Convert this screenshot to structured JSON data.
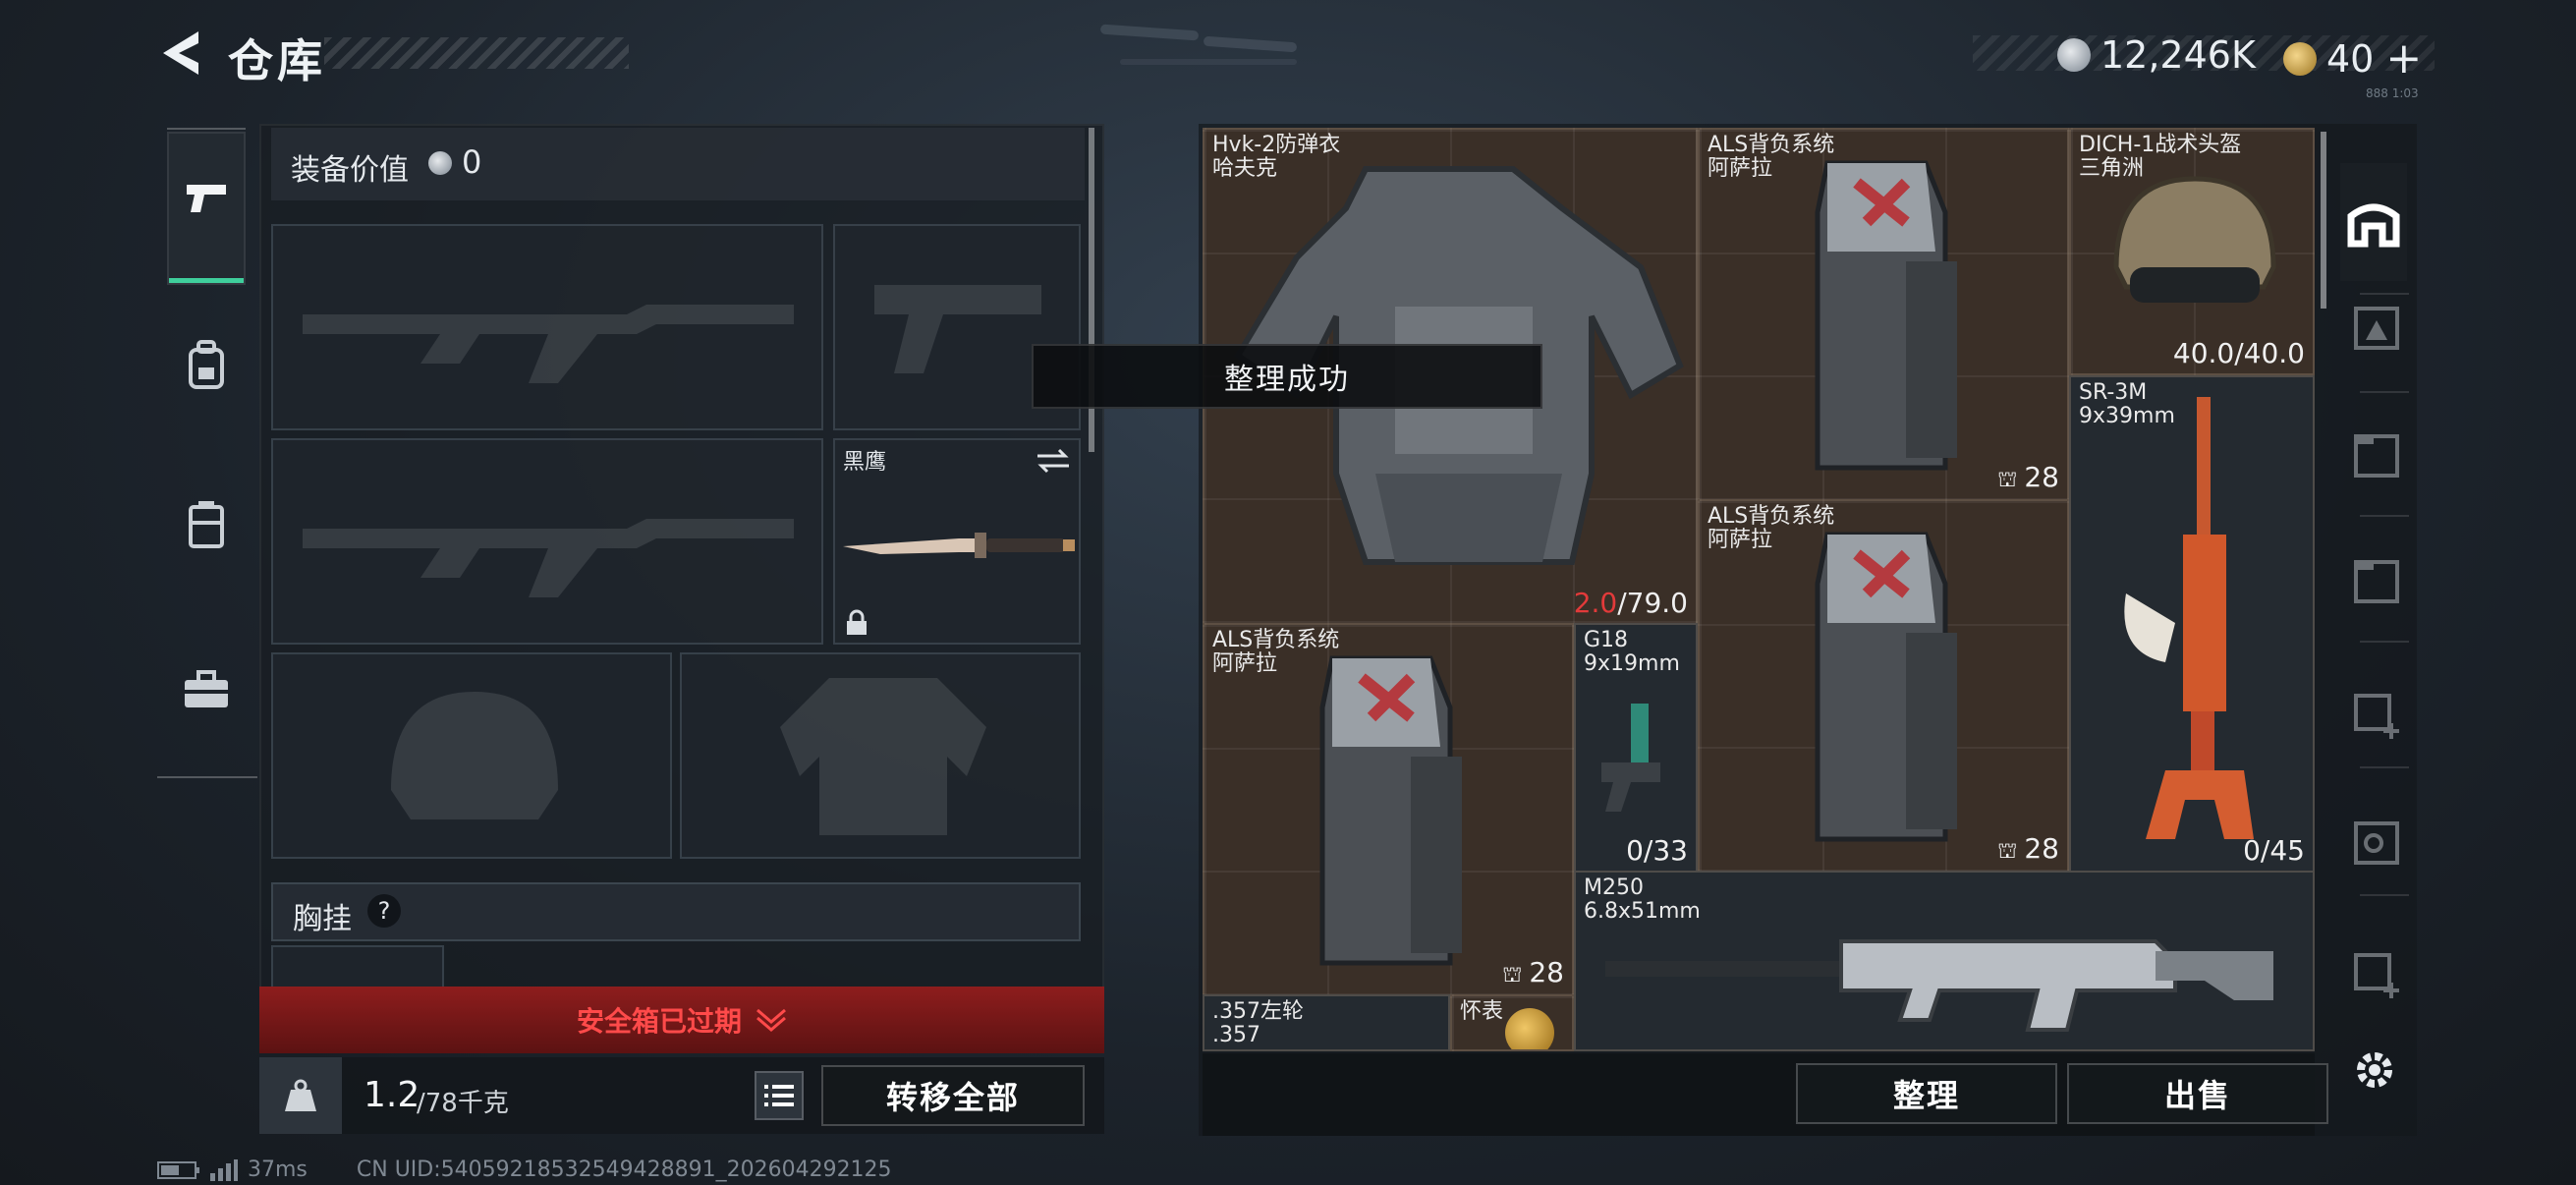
{
  "header": {
    "title": "仓库",
    "currency": {
      "silver": "12,246K",
      "gold": "40",
      "plus": "+"
    },
    "tiny": "888 1:03"
  },
  "loadout": {
    "value_label": "装备价值",
    "value": "0",
    "knife_label": "黑鹰",
    "chest_rig_label": "胸挂",
    "chest_rig_help": "?",
    "safebox_label": "安全箱已过期",
    "weight": "1.2",
    "weight_capacity": "/78千克",
    "transfer_all": "转移全部"
  },
  "toast": "整理成功",
  "stash": {
    "items": [
      {
        "name": "Hvk-2防弹衣",
        "sub": "哈夫克",
        "durability_current": "2.0",
        "durability_max": "/79.0"
      },
      {
        "name": "ALS背负系统",
        "sub": "阿萨拉",
        "count": "28"
      },
      {
        "name": "DICH-1战术头盔",
        "sub": "三角洲",
        "durability": "40.0/40.0"
      },
      {
        "name": "SR-3M",
        "sub": "9x39mm",
        "ammo": "0/45"
      },
      {
        "name": "ALS背负系统",
        "sub": "阿萨拉",
        "count": "28"
      },
      {
        "name": "ALS背负系统",
        "sub": "阿萨拉",
        "count": "28"
      },
      {
        "name": "G18",
        "sub": "9x19mm",
        "ammo": "0/33"
      },
      {
        "name": "M250",
        "sub": "6.8x51mm"
      },
      {
        "name": ".357左轮",
        "sub": ".357"
      },
      {
        "name": "怀表"
      }
    ],
    "sort": "整理",
    "sell": "出售"
  },
  "status": {
    "ping": "37ms",
    "uid": "CN UID:54059218532549428891_202604292125"
  },
  "colors": {
    "accent": "#3fcf9c",
    "danger": "#e23a3a",
    "danger_bg": "#8e1d1d",
    "gold": "#d6a64a"
  }
}
